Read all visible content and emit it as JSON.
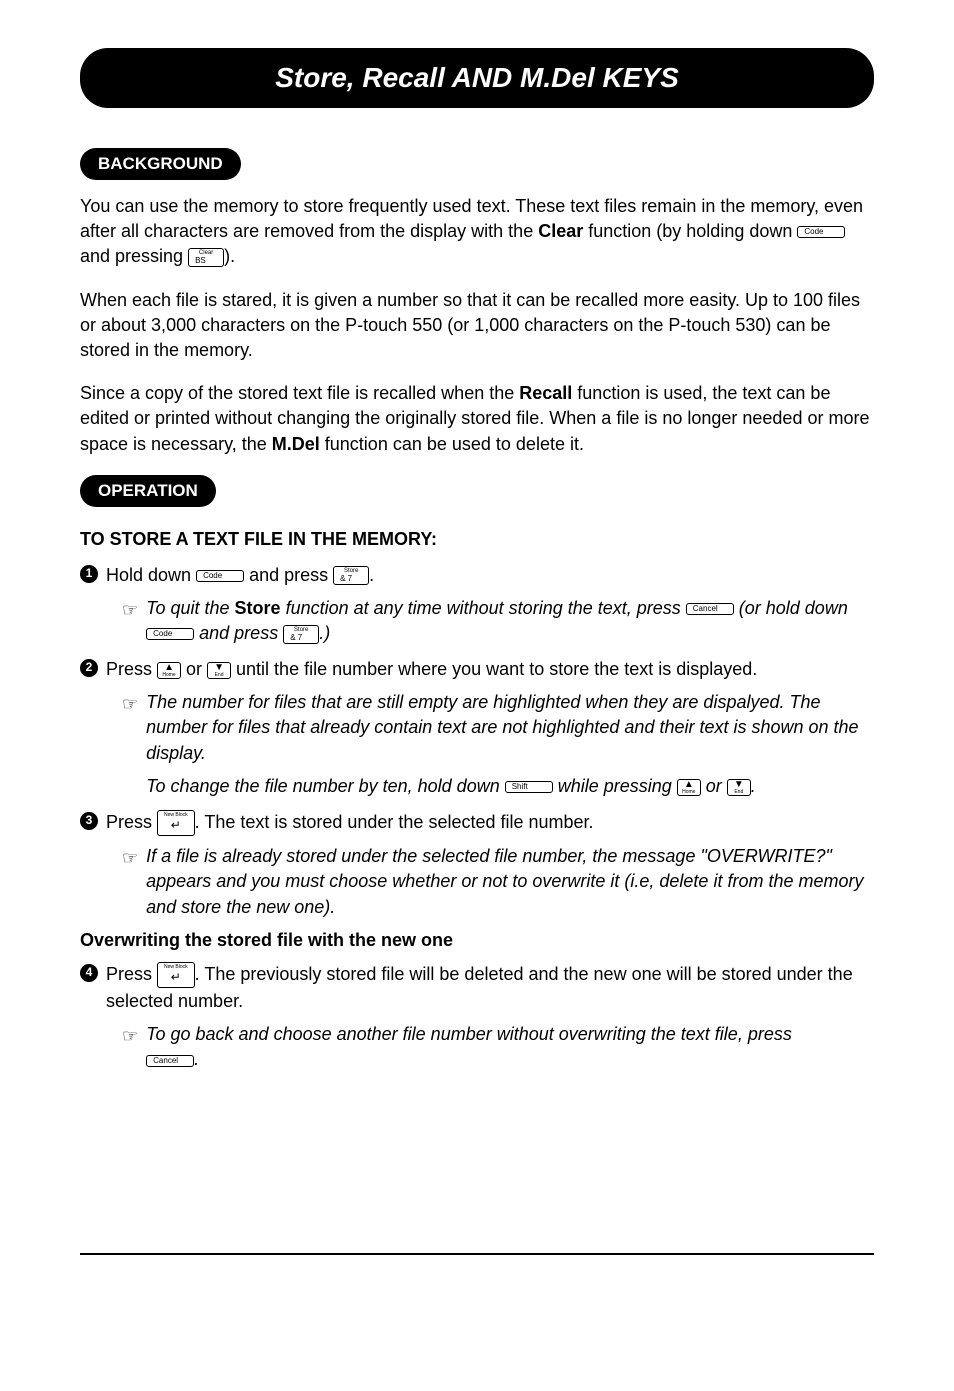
{
  "title": "Store, Recall AND M.Del KEYS",
  "sections": {
    "background": {
      "pill": "BACKGROUND",
      "p1a": "You can use the memory to store frequently used text.  These text files remain in the memory, even after all characters are removed from the display with the ",
      "p1_clear": "Clear",
      "p1b": " function (by holding down ",
      "p1c": " and pressing ",
      "p1d": ").",
      "p2": "When each file is stared, it is given a number so that it can be recalled more easity.  Up to 100 files or about 3,000 characters on the P-touch 550 (or 1,000 characters on the P-touch 530) can be stored in the memory.",
      "p3a": "Since a copy of the stored text file is recalled when the ",
      "p3_recall": "Recall",
      "p3b": "  function is used, the text can be edited or printed without changing the originally stored file.  When a file is no longer needed or more space is necessary, the ",
      "p3_mdel": "M.Del",
      "p3c": "  function can be used to delete it."
    },
    "operation": {
      "pill": "OPERATION",
      "subhead": "TO STORE A TEXT FILE IN THE MEMORY:",
      "step1a": "Hold down ",
      "step1b": " and press ",
      "step1c": ".",
      "note1a": "To quit the ",
      "note1_store": "Store",
      "note1b": " function at any time without storing the text, press ",
      "note1c": " (or hold down ",
      "note1d": " and press ",
      "note1e": ".)",
      "step2a": "Press ",
      "step2b": " or ",
      "step2c": " until the file number where you want to store the text is displayed.",
      "note2": "The number for files that are still empty are highlighted when they are dispalyed.  The number for files that already contain text are not highlighted and their text is shown on the display.",
      "note2b_a": "To change the file number by ten, hold down ",
      "note2b_b": " while pressing  ",
      "note2b_c": " or ",
      "note2b_d": ".",
      "step3a": "Press ",
      "step3b": ".  The text is stored under the selected file number.",
      "note3": "If a file is already stored under the selected file number, the message \"OVERWRITE?\" appears and you must choose whether or not to overwrite it (i.e, delete it from the memory and store the new one).",
      "overwrite_head": "Overwriting the stored file with the new one",
      "step4a": "Press  ",
      "step4b": ".  The previously stored file will be deleted and the new one will be stored under the selected number.",
      "note4a": "To go back and choose another file number without overwriting the text file, press ",
      "note4b": "."
    }
  },
  "keys": {
    "code": "Code",
    "bs_top": "Clear",
    "bs": "BS",
    "store_top": "Store",
    "store_main": "& 7",
    "cancel": "Cancel",
    "home_up": "▲",
    "home_lbl": "Home",
    "end_down": "▼",
    "end_lbl": "End",
    "shift": "Shift",
    "newblock": "New Block",
    "enter": "↵"
  }
}
